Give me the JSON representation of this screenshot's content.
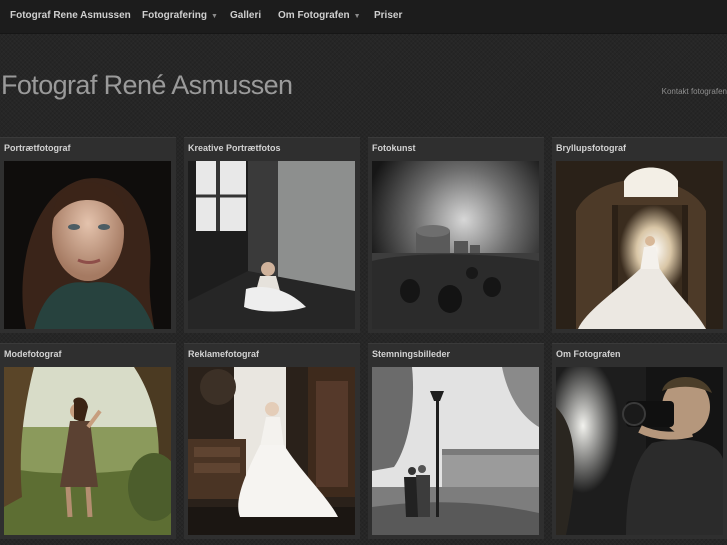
{
  "nav": {
    "brand": "Fotograf Rene Asmussen",
    "items": [
      {
        "label": "Fotografering",
        "dropdown": true
      },
      {
        "label": "Galleri",
        "dropdown": false
      },
      {
        "label": "Om Fotografen",
        "dropdown": true
      },
      {
        "label": "Priser",
        "dropdown": false
      }
    ],
    "caret": "▼"
  },
  "header": {
    "title": "Fotograf René Asmussen",
    "contact_link": "Kontakt fotografen"
  },
  "gallery": {
    "cards": [
      {
        "title": "Portrætfotograf",
        "photo_icon": "portrait-photo"
      },
      {
        "title": "Kreative Portrætfotos",
        "photo_icon": "creative-portrait-photo"
      },
      {
        "title": "Fotokunst",
        "photo_icon": "photo-art"
      },
      {
        "title": "Bryllupsfotograf",
        "photo_icon": "wedding-photo"
      },
      {
        "title": "Modefotograf",
        "photo_icon": "fashion-photo"
      },
      {
        "title": "Reklamefotograf",
        "photo_icon": "advertising-photo"
      },
      {
        "title": "Stemningsbilleder",
        "photo_icon": "mood-photo"
      },
      {
        "title": "Om Fotografen",
        "photo_icon": "photographer-photo"
      }
    ]
  },
  "colors": {
    "background": "#252525",
    "nav_background": "#1c1c1c",
    "card_background": "#2f2f2f",
    "title_text": "#9a9a9a"
  }
}
